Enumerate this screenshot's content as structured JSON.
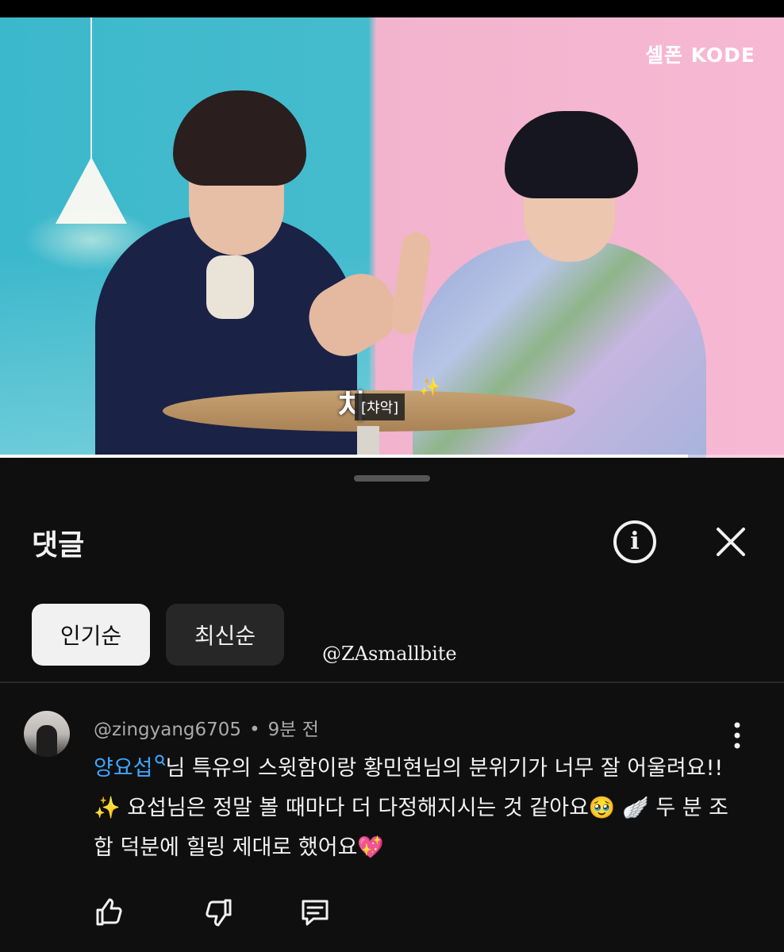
{
  "video": {
    "channel_logo": "셀폰 KODE",
    "caption_big": "차",
    "caption_box": "[챠악]",
    "sparkle_icon": "sparkles",
    "progress_fraction": 0.878
  },
  "comments_panel": {
    "title": "댓글",
    "info_icon": "info-circle",
    "close_icon": "close-x",
    "sort_chips": [
      "인기순",
      "최신순"
    ],
    "active_chip": "인기순",
    "watermark": "@ZAsmallbite"
  },
  "comment": {
    "author": "@zingyang6705",
    "separator": "•",
    "time": "9분 전",
    "mention": "양요섭",
    "text": "님 특유의 스윗함이랑 황민현님의 분위기가 너무 잘 어울려요!! ✨ 요섭님은 정말 볼 때마다 더 다정해지시는 것 같아요🥹 🪽 두 분 조합 덕분에 힐링 제대로 했어요💖",
    "actions": [
      "like",
      "dislike",
      "reply"
    ]
  },
  "colors": {
    "background": "#0f0f0f",
    "mention": "#3ea6ff",
    "chip_active": "#f1f1f1",
    "chip_inactive": "#272727",
    "meta_text": "#aaaaaa"
  }
}
